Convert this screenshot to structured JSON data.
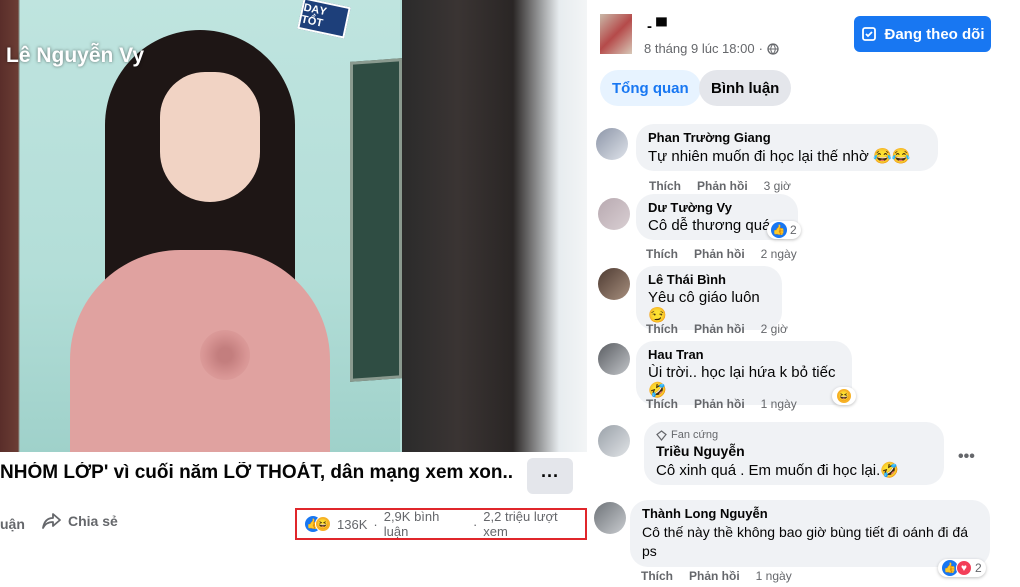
{
  "video": {
    "overlay_name": "Lê Nguyễn Vy",
    "sign_text": "DẠY TỐT"
  },
  "post": {
    "title": "NHÓM LỚP' vì cuối năm LỠ THOÁT, dân mạng xem xon...",
    "more_label": "···",
    "comment_action_partial": "uận",
    "share_label": "Chia sẻ",
    "reactions_count": "136K",
    "comments_count": "2,9K bình luận",
    "views_count": "2,2 triệu lượt xem",
    "highlight_color": "#e0262b"
  },
  "page": {
    "name": "-  ▀",
    "timestamp": "8 tháng 9 lúc 18:00",
    "follow_label": "Đang theo dõi",
    "tabs": [
      "Tổng quan",
      "Bình luận"
    ]
  },
  "comments": [
    {
      "name": "Phan Trường Giang",
      "text": "Tự nhiên muốn đi học lại thế nhờ 😂😂",
      "like": "Thích",
      "reply": "Phản hồi",
      "time": "3 giờ"
    },
    {
      "name": "Dư Tường Vy",
      "text": "Cô dễ thương quá",
      "like": "Thích",
      "reply": "Phản hồi",
      "time": "2 ngày",
      "reactions": "2"
    },
    {
      "name": "Lê Thái Bình",
      "text": "Yêu cô giáo luôn 😏",
      "like": "Thích",
      "reply": "Phản hồi",
      "time": "2 giờ"
    },
    {
      "name": "Hau Tran",
      "text": "Ùi trời.. học lại hứa k bỏ tiếc🤣",
      "like": "Thích",
      "reply": "Phản hồi",
      "time": "1 ngày"
    },
    {
      "badge": "Fan cứng",
      "name": "Triều Nguyễn",
      "text": "Cô xinh quá . Em muốn đi học lại.🤣"
    },
    {
      "name": "Thành Long Nguyễn",
      "text": "Cô thế này thề không bao giờ bùng tiết đi oánh đi đá ps",
      "like": "Thích",
      "reply": "Phản hồi",
      "time": "1 ngày",
      "reactions": "2"
    }
  ]
}
